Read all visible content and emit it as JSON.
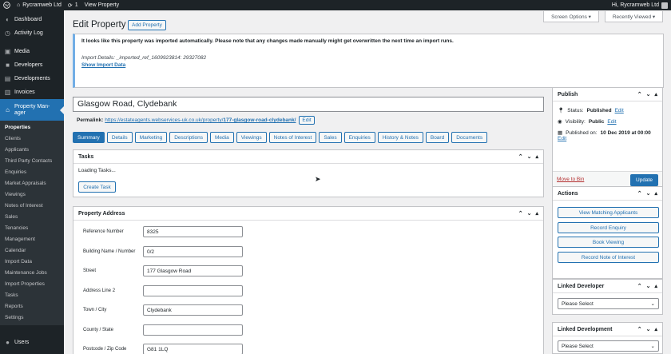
{
  "adminbar": {
    "site_name": "Rycramweb Ltd",
    "updates_count": "1",
    "view_property": "View Property",
    "greeting": "Hi, Rycramweb Ltd"
  },
  "sidebar": {
    "items": [
      {
        "label": "Dashboard",
        "icon": "dashboard-icon"
      },
      {
        "label": "Activity Log",
        "icon": "clock-icon"
      },
      {
        "label": "Media",
        "icon": "media-icon"
      },
      {
        "label": "Developers",
        "icon": "developers-icon"
      },
      {
        "label": "Developments",
        "icon": "developments-icon"
      },
      {
        "label": "Invoices",
        "icon": "invoices-icon"
      }
    ],
    "active": {
      "label_line1": "Property Man-",
      "label_line2": "ager"
    },
    "submenu": [
      "Properties",
      "Clients",
      "Applicants",
      "Third Party Contacts",
      "Enquiries",
      "Market Appraisals",
      "Viewings",
      "Notes of Interest",
      "Sales",
      "Tenancies",
      "Management",
      "Calendar",
      "Import Data",
      "Maintenance Jobs",
      "Import Properties",
      "Tasks",
      "Reports",
      "Settings"
    ],
    "users": "Users"
  },
  "header": {
    "screen_options": "Screen Options ▾",
    "recently_viewed": "Recently Viewed ▾",
    "title": "Edit Property",
    "add_new": "Add Property"
  },
  "notice": {
    "text": "It looks like this property was imported automatically. Please note that any changes made manually might get overwritten the next time an import runs.",
    "import_details": "Import Details: _imported_ref_1609923814: 29327082",
    "show_link": "Show Import Data"
  },
  "property": {
    "title": "Glasgow Road, Clydebank",
    "permalink_label": "Permalink:",
    "permalink_base": "https://estateagents.webservices-uk.co.uk/property/",
    "permalink_slug": "177-glasgow-road-clydebank/",
    "edit": "Edit"
  },
  "tabs": [
    "Summary",
    "Details",
    "Marketing",
    "Descriptions",
    "Media",
    "Viewings",
    "Notes of Interest",
    "Sales",
    "Enquiries",
    "History & Notes",
    "Board",
    "Documents"
  ],
  "tasks": {
    "title": "Tasks",
    "loading": "Loading Tasks...",
    "create": "Create Task"
  },
  "address": {
    "title": "Property Address",
    "fields": [
      {
        "label": "Reference Number",
        "value": "8325"
      },
      {
        "label": "Building Name / Number",
        "value": "0/2"
      },
      {
        "label": "Street",
        "value": "177 Glasgow Road"
      },
      {
        "label": "Address Line 2",
        "value": ""
      },
      {
        "label": "Town / City",
        "value": "Clydebank"
      },
      {
        "label": "County / State",
        "value": ""
      },
      {
        "label": "Postcode / Zip Code",
        "value": "G81 1LQ"
      }
    ]
  },
  "publish": {
    "title": "Publish",
    "status_label": "Status:",
    "status": "Published",
    "visibility_label": "Visibility:",
    "visibility": "Public",
    "published_on_label": "Published on:",
    "published_on": "10 Dec 2019 at 00:00",
    "edit": "Edit",
    "trash": "Move to Bin",
    "update": "Update"
  },
  "actions": {
    "title": "Actions",
    "buttons": [
      "View Matching Applicants",
      "Record Enquiry",
      "Book Viewing",
      "Record Note of Interest"
    ]
  },
  "linked_developer": {
    "title": "Linked Developer",
    "select": "Please Select"
  },
  "linked_development": {
    "title": "Linked Development",
    "select": "Please Select"
  },
  "colors": {
    "accent": "#2271b1",
    "sidebar": "#1d2327",
    "trash": "#b32d2e"
  }
}
